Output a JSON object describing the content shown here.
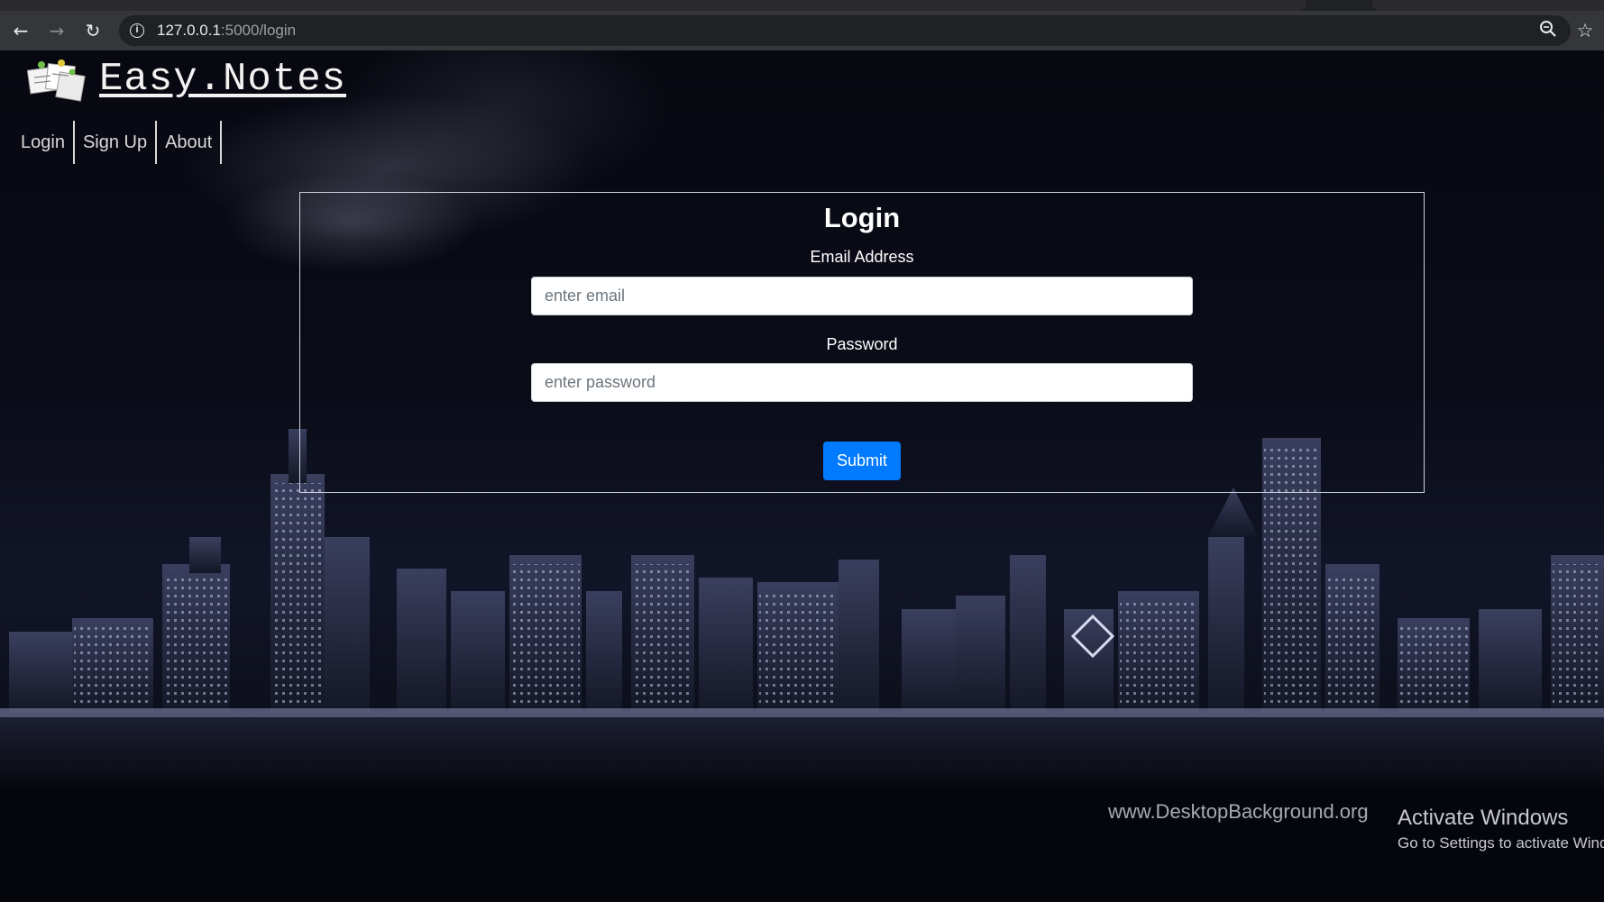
{
  "browser": {
    "back_icon": "arrow-left-icon",
    "forward_icon": "arrow-right-icon",
    "reload_icon": "reload-icon",
    "url_host": "127.0.0.1",
    "url_path": ":5000/login",
    "zoom_icon": "zoom-icon",
    "star_icon": "star-icon"
  },
  "brand": {
    "title": "Easy.Notes",
    "logo_icon": "sticky-notes-logo"
  },
  "nav": {
    "items": [
      {
        "label": "Login"
      },
      {
        "label": "Sign Up"
      },
      {
        "label": "About"
      }
    ]
  },
  "login": {
    "title": "Login",
    "email_label": "Email Address",
    "email_placeholder": "enter email",
    "email_value": "",
    "password_label": "Password",
    "password_placeholder": "enter password",
    "password_value": "",
    "submit_label": "Submit",
    "submit_color": "#007bff"
  },
  "background": {
    "watermark": "www.DesktopBackground.org"
  },
  "os_notice": {
    "title": "Activate Windows",
    "subtitle": "Go to Settings to activate Windows."
  }
}
